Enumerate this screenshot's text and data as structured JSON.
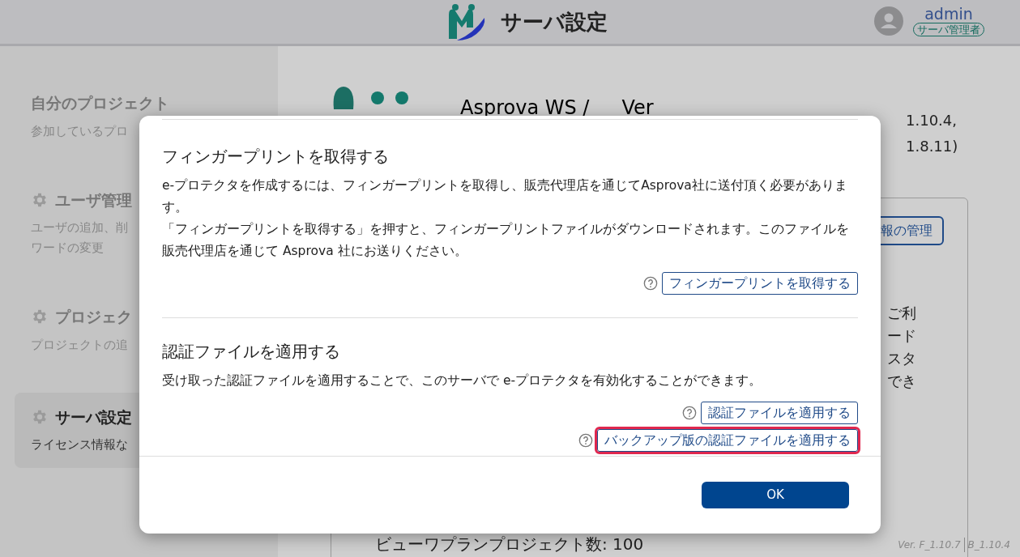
{
  "header": {
    "title": "サーバ設定",
    "user": {
      "name": "admin",
      "role": "サーバ管理者"
    }
  },
  "sidebar": {
    "items": [
      {
        "title": "自分のプロジェクト",
        "description": [
          "参加しているプロ"
        ],
        "icon": false,
        "selected": false
      },
      {
        "title": "ユーザ管理",
        "description": [
          "ユーザの追加、削",
          "ワードの変更"
        ],
        "icon": true,
        "selected": false
      },
      {
        "title": "プロジェク",
        "description": [
          "プロジェクトの追"
        ],
        "icon": true,
        "selected": false
      },
      {
        "title": "サーバ設定",
        "description": [
          "ライセンス情報な"
        ],
        "icon": true,
        "selected": true
      }
    ]
  },
  "main": {
    "product_title": "Asprova WS /",
    "product_version_label": "Ver",
    "version_lines": [
      "1.10.4,",
      "1.8.11)"
    ],
    "license_button": "報の管理",
    "text_fragments": [
      "ご利",
      "ード",
      "スタ",
      "でき"
    ],
    "view_plan_count": "ビューワプランプロジェクト数: 100"
  },
  "footer": {
    "version_frontend": "Ver. F_1.10.7",
    "version_backend": "B_1.10.4"
  },
  "dialog": {
    "sections": [
      {
        "title": "フィンガープリントを取得する",
        "paragraphs": [
          "e-プロテクタを作成するには、フィンガープリントを取得し、販売代理店を通じてAsprova社に送付頂く必要があります。",
          "「フィンガープリントを取得する」を押すと、フィンガープリントファイルがダウンロードされます。このファイルを販売代理店を通じて Asprova 社にお送りください。"
        ],
        "buttons": [
          {
            "label": "フィンガープリントを取得する",
            "highlighted": false
          }
        ]
      },
      {
        "title": "認証ファイルを適用する",
        "paragraphs": [
          "受け取った認証ファイルを適用することで、このサーバで e-プロテクタを有効化することができます。"
        ],
        "buttons": [
          {
            "label": "認証ファイルを適用する",
            "highlighted": false
          },
          {
            "label": "バックアップ版の認証ファイルを適用する",
            "highlighted": true
          }
        ]
      }
    ],
    "ok_button": "OK"
  }
}
